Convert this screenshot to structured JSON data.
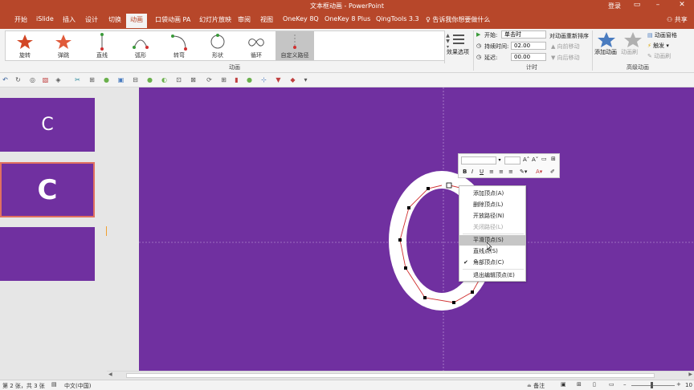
{
  "window": {
    "title": "文本框动画 - PowerPoint",
    "login": "登录"
  },
  "tabs": [
    "开始",
    "iSlide",
    "插入",
    "设计",
    "切换",
    "动画",
    "口袋动画 PA",
    "幻灯片放映",
    "审阅",
    "视图",
    "OneKey 8Q",
    "OneKey 8 Plus",
    "QingTools 3.3"
  ],
  "tell_me": "告诉我你想要做什么",
  "share": "共享",
  "animations": [
    "旋转",
    "弹跳",
    "直线",
    "弧形",
    "转弯",
    "形状",
    "循环",
    "自定义路径"
  ],
  "ribbon": {
    "group_animation": "动画",
    "group_timing": "计时",
    "group_advanced": "高级动画",
    "effect_options": "效果选项",
    "start_label": "开始:",
    "start_value": "单击时",
    "duration_label": "持续时间:",
    "duration_value": "02.00",
    "delay_label": "延迟:",
    "delay_value": "00.00",
    "reorder": "对动画重新排序",
    "move_earlier": "向前移动",
    "move_later": "向后移动",
    "add_animation": "添加动画",
    "anim_painter": "动画刷",
    "anim_pane": "动画窗格",
    "trigger": "触发",
    "anim_brush": "动画刷"
  },
  "thumbnails": [
    "C",
    "C"
  ],
  "slide_letter": "O",
  "context_menu": [
    "添加顶点(A)",
    "删除顶点(L)",
    "开放路径(N)",
    "关闭路径(L)",
    "平滑顶点(S)",
    "直线点(S)",
    "角部顶点(C)",
    "退出编辑顶点(E)"
  ],
  "status": {
    "slide_info": "第 2 张，共 3 张",
    "language": "中文(中国)",
    "notes": "备注",
    "zoom": "10"
  },
  "colors": {
    "accent": "#b7472a",
    "slide": "#7030a0"
  }
}
